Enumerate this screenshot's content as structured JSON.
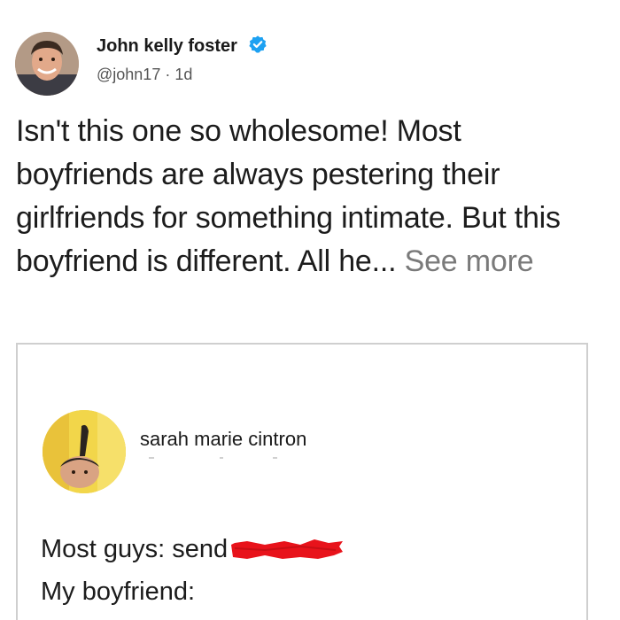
{
  "post": {
    "author": {
      "name": "John kelly foster",
      "handle": "@john17",
      "separator": "·",
      "age": "1d",
      "verified_icon": "verified-badge-icon",
      "verified_color": "#1da1f2",
      "avatar": "profile-photo"
    },
    "text": "Isn't this one so wholesome! Most boyfriends are always pestering their girlfriends for something intimate. But this boyfriend is different. All he...",
    "see_more": "See more"
  },
  "embed": {
    "author_name": "sarah marie cintron",
    "avatar": "profile-photo",
    "line1_label": "Most guys: send",
    "redaction_icon": "red-scribble-redaction",
    "redaction_color": "#e8131b",
    "line2_label": "My boyfriend:"
  },
  "colors": {
    "text": "#1c1c1c",
    "muted": "#7a7a7a",
    "border": "#cfcfcf"
  }
}
